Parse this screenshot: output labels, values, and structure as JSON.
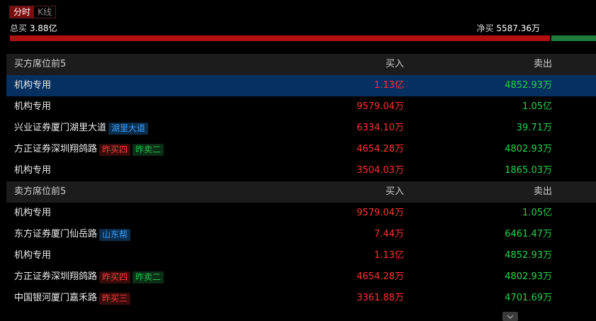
{
  "tabs": [
    {
      "label": "分时",
      "active": true
    },
    {
      "label": "K线",
      "active": false
    }
  ],
  "summary": {
    "total_buy_label": "总买",
    "total_buy_value": "3.88亿",
    "net_buy_label": "净买",
    "net_buy_value": "5587.36万"
  },
  "colors": {
    "buy": "#b30f0f",
    "sell": "#1e7d3a",
    "highlight": "#05305f"
  },
  "buyers": {
    "header": {
      "title": "买方席位前5",
      "buy": "买入",
      "sell": "卖出"
    },
    "rows": [
      {
        "name": "机构专用",
        "tags": [],
        "buy": "1.13亿",
        "sell": "4852.93万",
        "highlight": true
      },
      {
        "name": "机构专用",
        "tags": [],
        "buy": "9579.04万",
        "sell": "1.05亿"
      },
      {
        "name": "兴业证券厦门湖里大道",
        "tags": [
          {
            "text": "湖里大道",
            "color": "blue"
          }
        ],
        "buy": "6334.10万",
        "sell": "39.71万"
      },
      {
        "name": "方正证券深圳翔鸽路",
        "tags": [
          {
            "text": "昨买四",
            "color": "red"
          },
          {
            "text": "昨卖二",
            "color": "green"
          }
        ],
        "buy": "4654.28万",
        "sell": "4802.93万"
      },
      {
        "name": "机构专用",
        "tags": [],
        "buy": "3504.03万",
        "sell": "1865.03万"
      }
    ]
  },
  "sellers": {
    "header": {
      "title": "卖方席位前5",
      "buy": "买入",
      "sell": "卖出"
    },
    "rows": [
      {
        "name": "机构专用",
        "tags": [],
        "buy": "9579.04万",
        "sell": "1.05亿"
      },
      {
        "name": "东方证券厦门仙岳路",
        "tags": [
          {
            "text": "山东帮",
            "color": "blue"
          }
        ],
        "buy": "7.44万",
        "sell": "6461.47万"
      },
      {
        "name": "机构专用",
        "tags": [],
        "buy": "1.13亿",
        "sell": "4852.93万"
      },
      {
        "name": "方正证券深圳翔鸽路",
        "tags": [
          {
            "text": "昨买四",
            "color": "red"
          },
          {
            "text": "昨卖二",
            "color": "green"
          }
        ],
        "buy": "4654.28万",
        "sell": "4802.93万"
      },
      {
        "name": "中国银河厦门嘉禾路",
        "tags": [
          {
            "text": "昨买三",
            "color": "red"
          }
        ],
        "buy": "3361.88万",
        "sell": "4701.69万"
      }
    ]
  },
  "icons": {
    "scroll_more": "chevron-down-icon"
  }
}
